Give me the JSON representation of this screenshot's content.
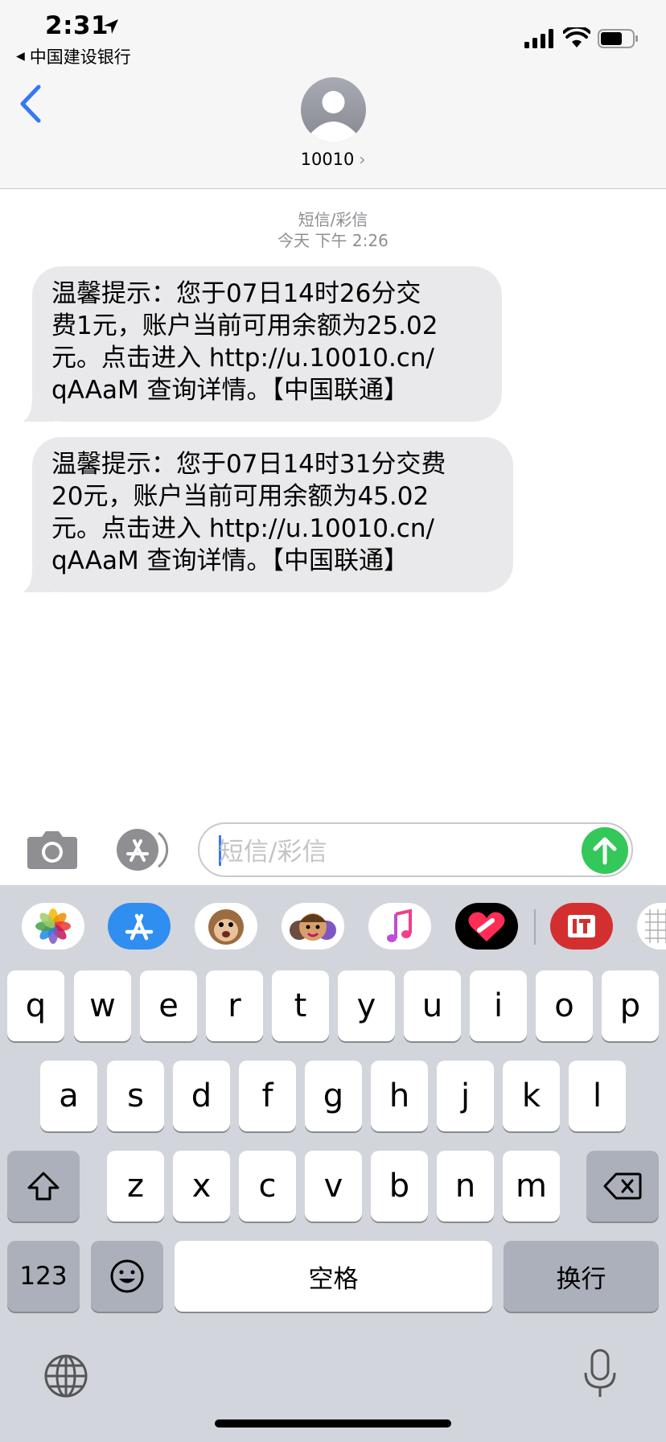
{
  "status_bar": {
    "time": "2:31",
    "back_app_label": "中国建设银行",
    "icons": [
      "location-arrow-icon",
      "cellular-signal-icon",
      "wifi-icon",
      "battery-icon"
    ]
  },
  "nav": {
    "contact_name": "10010",
    "contact_chevron": "›"
  },
  "conversation": {
    "service_label": "短信/彩信",
    "timestamp": "今天 下午 2:26",
    "messages": [
      {
        "lines": [
          "温馨提示：您于07日14时26分交",
          "费1元，账户当前可用余额为25.02",
          "元。点击进入 http://u.10010.cn/",
          "qAAaM 查询详情。【中国联通】"
        ]
      },
      {
        "lines": [
          "温馨提示：您于07日14时31分交费",
          "20元，账户当前可用余额为45.02",
          "元。点击进入 http://u.10010.cn/",
          "qAAaM 查询详情。【中国联通】"
        ]
      }
    ]
  },
  "input": {
    "placeholder": "短信/彩信"
  },
  "app_strip": {
    "apps": [
      "photos-app-icon",
      "app-store-app-icon",
      "animoji-app-icon",
      "memoji-app-icon",
      "music-app-icon",
      "digital-touch-app-icon",
      "it-app-icon",
      "grid-app-icon"
    ]
  },
  "keyboard": {
    "row1": [
      "q",
      "w",
      "e",
      "r",
      "t",
      "y",
      "u",
      "i",
      "o",
      "p"
    ],
    "row2": [
      "a",
      "s",
      "d",
      "f",
      "g",
      "h",
      "j",
      "k",
      "l"
    ],
    "row3": [
      "z",
      "x",
      "c",
      "v",
      "b",
      "n",
      "m"
    ],
    "numbers_label": "123",
    "space_label": "空格",
    "return_label": "换行"
  },
  "colors": {
    "accent_blue": "#3478f6",
    "send_green": "#34c759",
    "bubble_gray": "#e9e9eb",
    "keyboard_bg": "#d2d5db"
  }
}
